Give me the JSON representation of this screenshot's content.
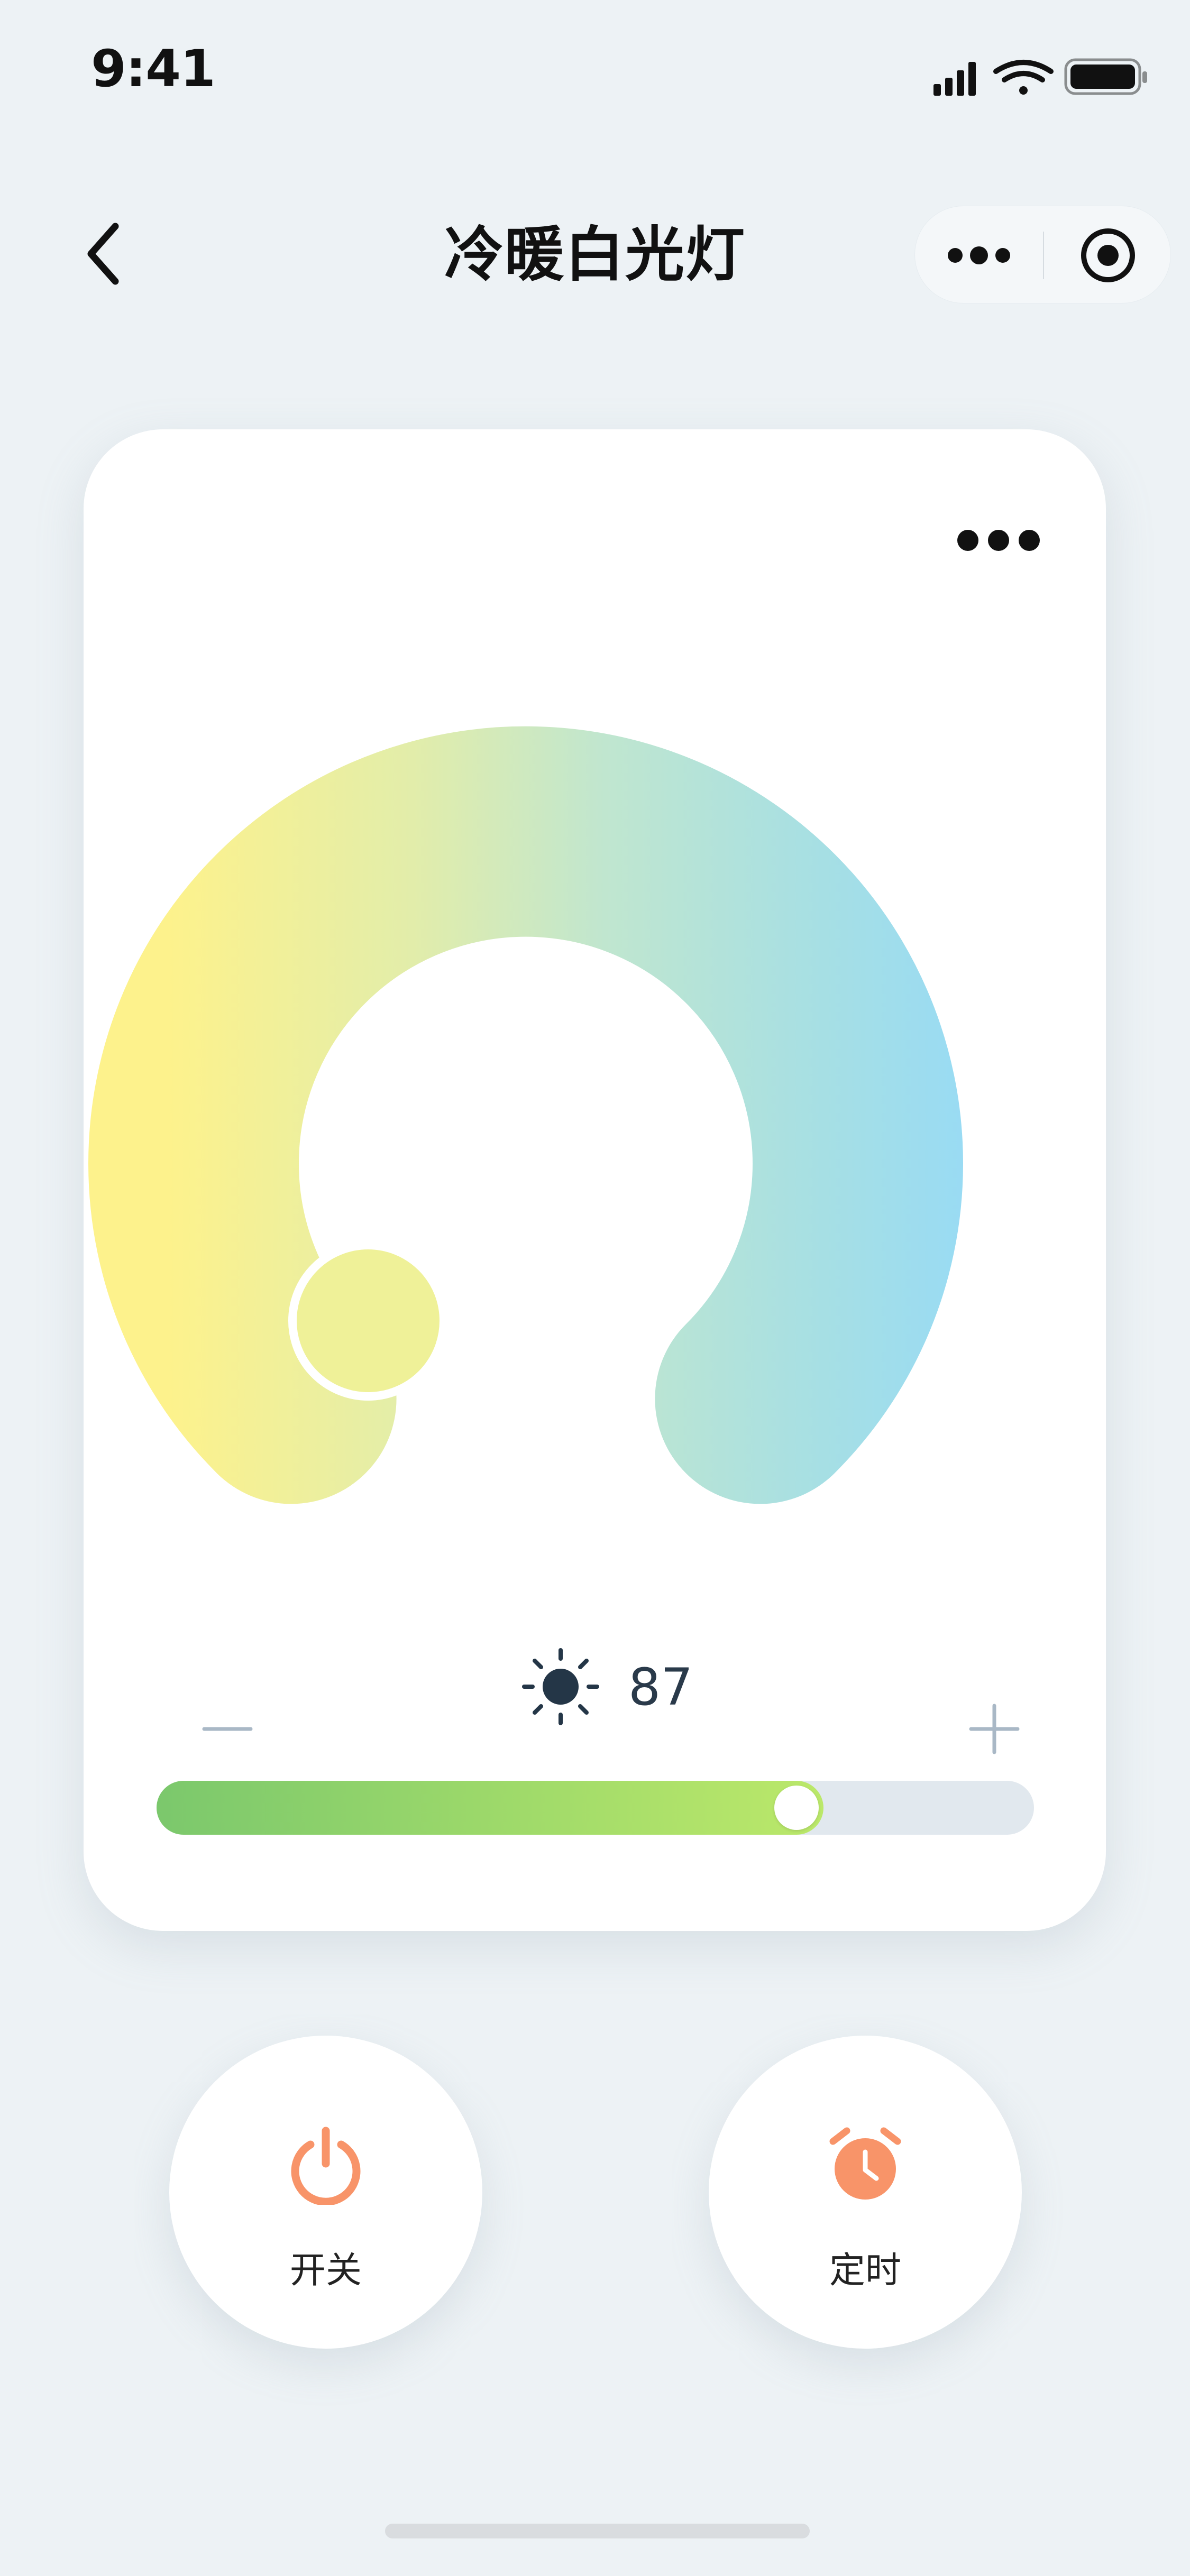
{
  "status_bar": {
    "time": "9:41",
    "icons": [
      "signal-icon",
      "wifi-icon",
      "battery-icon"
    ]
  },
  "nav": {
    "title": "冷暖白光灯",
    "back_icon": "chevron-left-icon",
    "capsule_more_icon": "more-dots-icon",
    "capsule_close_icon": "target-icon"
  },
  "card": {
    "more_icon": "more-dots-icon",
    "color_temperature": {
      "warm_color": "#fdf28c",
      "mid_color": "#c0e6cf",
      "cool_color": "#92d9fc",
      "knob_position": "warm end"
    },
    "brightness": {
      "icon": "sun-icon",
      "value": "87",
      "level_percent": 76,
      "minus_icon": "minus-icon",
      "plus_icon": "plus-icon"
    }
  },
  "actions": {
    "power": {
      "icon": "power-icon",
      "label": "开关"
    },
    "timer": {
      "icon": "alarm-clock-icon",
      "label": "定时"
    }
  },
  "colors": {
    "background": "#edf2f5",
    "accent_orange": "#f89469",
    "slider_green": "#7bc86c",
    "slider_track": "#e1e8ee"
  }
}
